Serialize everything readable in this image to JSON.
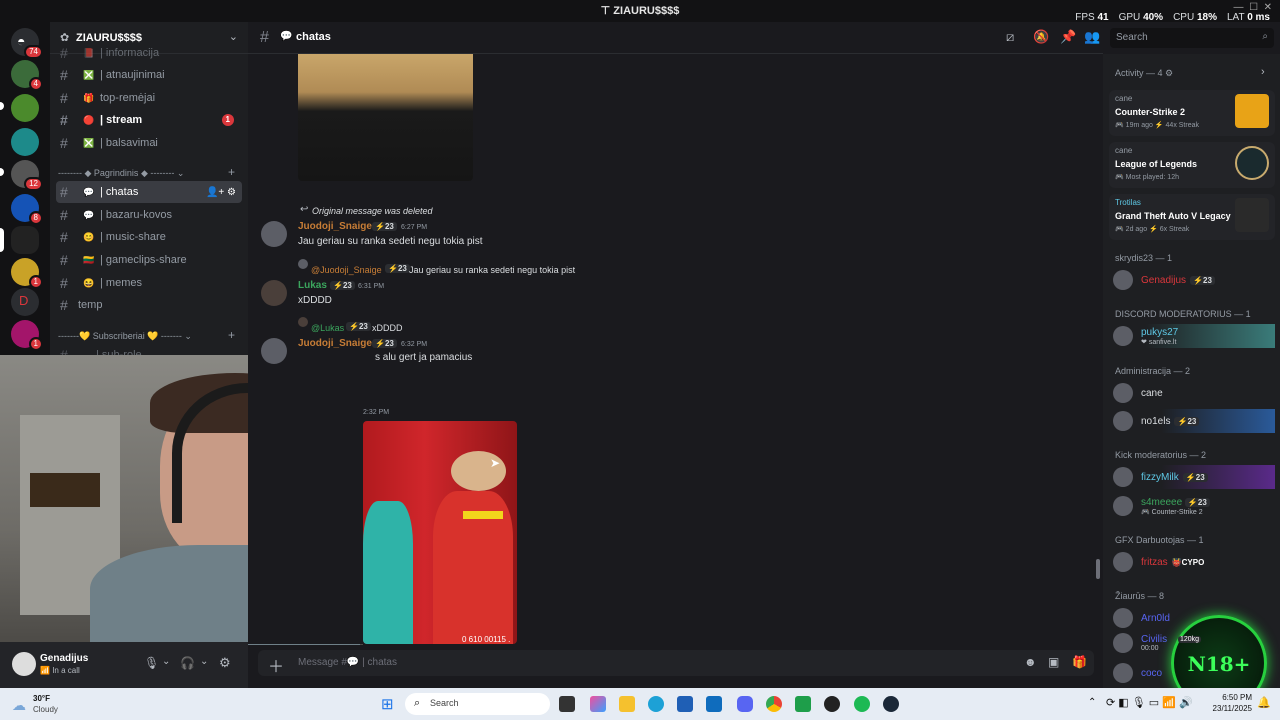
{
  "window": {
    "title": "ZIAURU$$$$",
    "stats": [
      {
        "label": "FPS",
        "value": "41"
      },
      {
        "label": "GPU",
        "value": "40%"
      },
      {
        "label": "CPU",
        "value": "18%"
      },
      {
        "label": "LAT",
        "value": "0 ms"
      }
    ]
  },
  "server": {
    "name": "ZIAURU$$$$",
    "rail_badges": [
      "74",
      "4",
      "12",
      "8",
      "1",
      "1"
    ]
  },
  "channels": [
    {
      "name": "| informacija",
      "emoji": "📕"
    },
    {
      "name": "| atnaujinimai",
      "emoji": "❎"
    },
    {
      "name": "top-remėjai",
      "emoji": "🎁"
    },
    {
      "name": "| stream",
      "emoji": "🔴",
      "bold": true,
      "unread": "1"
    },
    {
      "name": "| balsavimai",
      "emoji": "❎"
    }
  ],
  "category_main": "Pagrindinis",
  "channels_main": [
    {
      "name": "| chatas",
      "emoji": "💬",
      "active": true
    },
    {
      "name": "| bazaru-kovos",
      "emoji": "💬"
    },
    {
      "name": "| music-share",
      "emoji": "😊"
    },
    {
      "name": "| gameclips-share",
      "emoji": "🇱🇹"
    },
    {
      "name": "| memes",
      "emoji": "😆"
    },
    {
      "name": "temp",
      "emoji": ""
    }
  ],
  "category_subs": "Subscriberiai",
  "channel_sub_partial": "| sub-role",
  "user": {
    "name": "Genadijus",
    "status": "In a call"
  },
  "chat": {
    "channel": "chatas",
    "search_placeholder": "Search",
    "composer_placeholder": "Message #💬 | chatas"
  },
  "messages": [
    {
      "reply": "Original message was deleted",
      "author": "Juodoji_Snaige",
      "badge": "23",
      "time": "6:27 PM",
      "text": "Jau geriau su ranka sedeti negu tokia pist",
      "author_color": "#c77d36"
    },
    {
      "reply_author": "@Juodoji_Snaige",
      "reply_badge": "23",
      "reply": "Jau geriau su ranka sedeti negu tokia pist",
      "author": "Lukas",
      "badge": "23",
      "time": "6:31 PM",
      "text": "xDDDD",
      "author_color": "#3ba55d"
    },
    {
      "reply_author": "@Lukas",
      "reply_badge": "23",
      "reply": "xDDDD",
      "author": "Juodoji_Snaige",
      "badge": "23",
      "time": "6:32 PM",
      "text": "s alu gert ja pamacius",
      "author_color": "#c77d36"
    }
  ],
  "partial_time": "2:32 PM",
  "video_timecode": "0 610 00115 .",
  "activity": {
    "header": "Activity — 4",
    "cards": [
      {
        "user": "cane",
        "game": "Counter-Strike 2",
        "meta1": "19m ago",
        "meta2": "44x Streak"
      },
      {
        "user": "cane",
        "game": "League of Legends",
        "meta1": "Most played: 12h",
        "meta2": ""
      },
      {
        "user": "Trotilas",
        "game": "Grand Theft Auto V Legacy",
        "meta1": "2d ago",
        "meta2": "6x Streak"
      }
    ]
  },
  "member_groups": [
    {
      "title": "skrydis23 — 1",
      "members": [
        {
          "name": "Genadijus",
          "badge": "23",
          "color": "#da373c"
        }
      ]
    },
    {
      "title": "DISCORD MODERATORIUS — 1",
      "members": [
        {
          "name": "pukys27",
          "sub": "sanfive.lt",
          "color": "#5ec8e5"
        }
      ]
    },
    {
      "title": "Administracija — 2",
      "members": [
        {
          "name": "cane",
          "color": "#dbdee1"
        },
        {
          "name": "no1els",
          "badge": "23",
          "color": "#dbdee1"
        }
      ]
    },
    {
      "title": "Kick moderatorius — 2",
      "members": [
        {
          "name": "fizzyMilk",
          "badge": "23",
          "color": "#5ec8e5"
        },
        {
          "name": "s4meeee",
          "badge": "23",
          "sub": "Counter-Strike 2",
          "color": "#3ba55d"
        }
      ]
    },
    {
      "title": "GFX Darbuotojas — 1",
      "members": [
        {
          "name": "fritzas",
          "tag": "CYPO",
          "color": "#da373c"
        }
      ]
    },
    {
      "title": "Žiaurūs — 8",
      "members": [
        {
          "name": "Arn0ld",
          "color": "#5865f2"
        },
        {
          "name": "Civilis",
          "sub": "00:00",
          "color": "#5865f2"
        },
        {
          "name": "coco",
          "color": "#5865f2"
        }
      ]
    }
  ],
  "overlay": {
    "badge_text": "N18+",
    "civilis_tag": "120kg"
  },
  "taskbar": {
    "weather_temp": "30°F",
    "weather_desc": "Cloudy",
    "search": "Search",
    "time": "6:50 PM",
    "date": "23/11/2025"
  }
}
